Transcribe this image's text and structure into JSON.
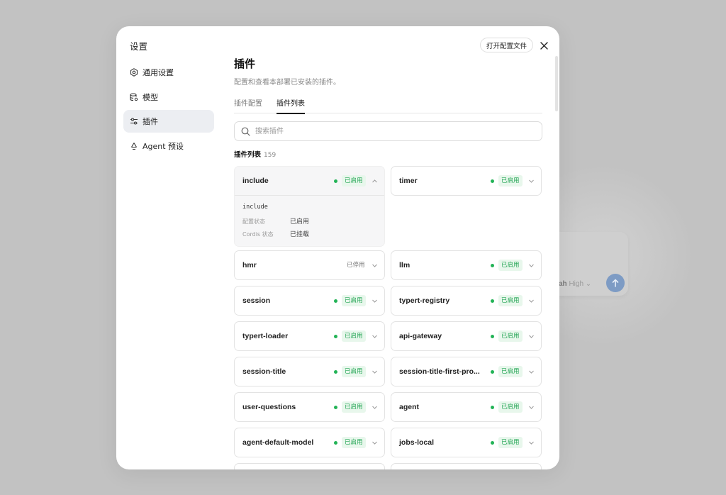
{
  "background": {
    "model_text_bold": "ah",
    "model_text": "High",
    "accent_color": "#7d9bc4"
  },
  "sidebar": {
    "title": "设置",
    "items": [
      {
        "label": "通用设置",
        "icon": "settings-hex-icon",
        "active": false
      },
      {
        "label": "模型",
        "icon": "database-gear-icon",
        "active": false
      },
      {
        "label": "插件",
        "icon": "sliders-icon",
        "active": true
      },
      {
        "label": "Agent 预设",
        "icon": "recycle-icon",
        "active": false
      }
    ]
  },
  "header": {
    "open_config_label": "打开配置文件",
    "close_icon": "close-icon"
  },
  "main": {
    "title": "插件",
    "subtitle": "配置和查看本部署已安装的插件。",
    "tabs": [
      {
        "label": "插件配置",
        "active": false
      },
      {
        "label": "插件列表",
        "active": true
      }
    ],
    "search_placeholder": "搜索插件",
    "list_title": "插件列表",
    "list_count": "159"
  },
  "status_colors": {
    "enabled_text": "#23a554",
    "enabled_bg": "#e8f7ec",
    "dot": "#22b356"
  },
  "plugins": [
    {
      "name": "include",
      "status": "已启用",
      "enabled": true,
      "expanded": true,
      "detail": {
        "id": "include",
        "config_label": "配置状态",
        "config_value": "已启用",
        "cordis_label": "Cordis 状态",
        "cordis_value": "已挂载"
      }
    },
    {
      "name": "timer",
      "status": "已启用",
      "enabled": true
    },
    {
      "name": "hmr",
      "status": "已停用",
      "enabled": false
    },
    {
      "name": "llm",
      "status": "已启用",
      "enabled": true
    },
    {
      "name": "session",
      "status": "已启用",
      "enabled": true
    },
    {
      "name": "typert-registry",
      "status": "已启用",
      "enabled": true
    },
    {
      "name": "typert-loader",
      "status": "已启用",
      "enabled": true
    },
    {
      "name": "api-gateway",
      "status": "已启用",
      "enabled": true
    },
    {
      "name": "session-title",
      "status": "已启用",
      "enabled": true
    },
    {
      "name": "session-title-first-pro...",
      "status": "已启用",
      "enabled": true
    },
    {
      "name": "user-questions",
      "status": "已启用",
      "enabled": true
    },
    {
      "name": "agent",
      "status": "已启用",
      "enabled": true
    },
    {
      "name": "agent-default-model",
      "status": "已启用",
      "enabled": true
    },
    {
      "name": "jobs-local",
      "status": "已启用",
      "enabled": true
    }
  ]
}
